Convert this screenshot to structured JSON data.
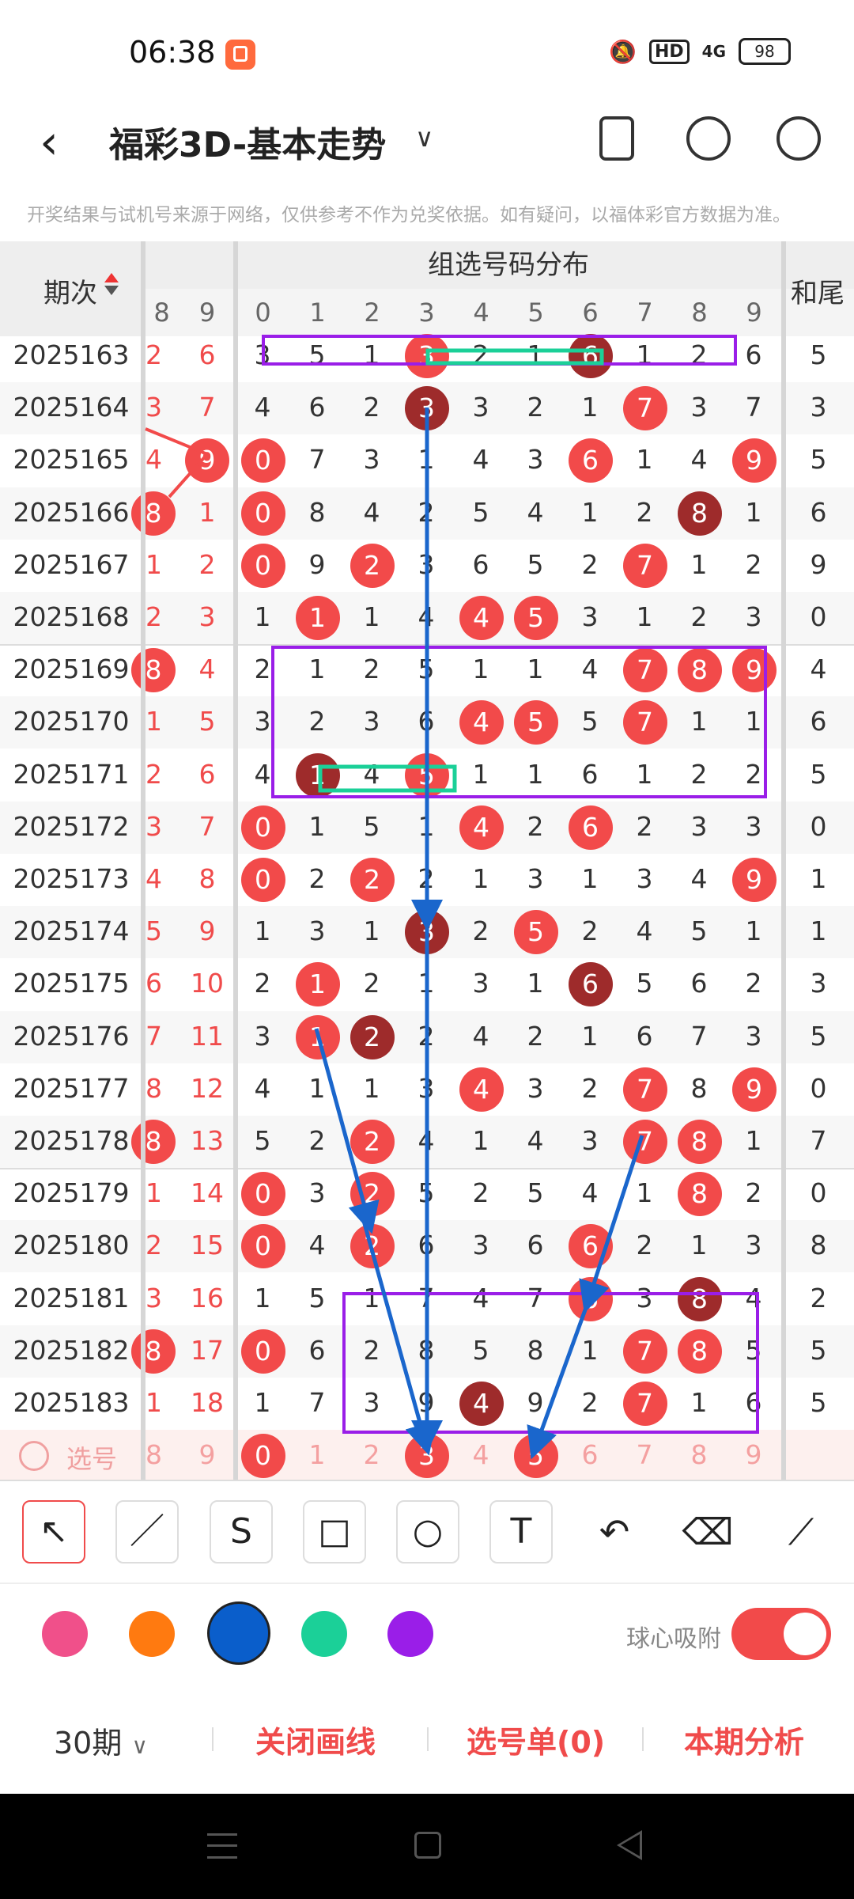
{
  "status": {
    "time": "06:38",
    "hd": "HD",
    "network": "4G",
    "battery": "98"
  },
  "header": {
    "title": "福彩3D-基本走势"
  },
  "disclaimer": "开奖结果与试机号来源于网络，仅供参考不作为兑奖依据。如有疑问，以福体彩官方数据为准。",
  "table": {
    "period_header": "期次",
    "group_header": "组选号码分布",
    "sum_header": "和尾",
    "partial_headers": [
      "8",
      "9"
    ],
    "digit_headers": [
      "0",
      "1",
      "2",
      "3",
      "4",
      "5",
      "6",
      "7",
      "8",
      "9"
    ],
    "rows": [
      {
        "period": "2025163",
        "a": "2",
        "b": "6",
        "g": [
          "3",
          "5",
          "1",
          "3",
          "2",
          "1",
          "6",
          "1",
          "2",
          "6"
        ],
        "balls": [
          3,
          6
        ],
        "dark": [
          6
        ],
        "sum": "5"
      },
      {
        "period": "2025164",
        "a": "3",
        "b": "7",
        "g": [
          "4",
          "6",
          "2",
          "3",
          "3",
          "2",
          "1",
          "7",
          "3",
          "7"
        ],
        "balls": [
          3,
          7
        ],
        "dark": [
          3
        ],
        "sum": "3"
      },
      {
        "period": "2025165",
        "a": "4",
        "b": "9",
        "g": [
          "0",
          "7",
          "3",
          "1",
          "4",
          "3",
          "6",
          "1",
          "4",
          "9"
        ],
        "balls": [
          0,
          6,
          9
        ],
        "dark": [],
        "sum": "5",
        "bBall": true
      },
      {
        "period": "2025166",
        "a": "8",
        "b": "1",
        "g": [
          "0",
          "8",
          "4",
          "2",
          "5",
          "4",
          "1",
          "2",
          "8",
          "1"
        ],
        "balls": [
          0,
          8
        ],
        "dark": [
          8
        ],
        "sum": "6",
        "aBall": true
      },
      {
        "period": "2025167",
        "a": "1",
        "b": "2",
        "g": [
          "0",
          "9",
          "2",
          "3",
          "6",
          "5",
          "2",
          "7",
          "1",
          "2"
        ],
        "balls": [
          0,
          2,
          7
        ],
        "dark": [],
        "sum": "9"
      },
      {
        "period": "2025168",
        "a": "2",
        "b": "3",
        "g": [
          "1",
          "1",
          "1",
          "4",
          "4",
          "5",
          "3",
          "1",
          "2",
          "3"
        ],
        "balls": [
          1,
          4,
          5
        ],
        "dark": [],
        "sum": "0"
      },
      {
        "period": "2025169",
        "a": "8",
        "b": "4",
        "g": [
          "2",
          "1",
          "2",
          "5",
          "1",
          "1",
          "4",
          "7",
          "8",
          "9"
        ],
        "balls": [
          7,
          8,
          9
        ],
        "dark": [],
        "sum": "4",
        "aBall": true
      },
      {
        "period": "2025170",
        "a": "1",
        "b": "5",
        "g": [
          "3",
          "2",
          "3",
          "6",
          "4",
          "5",
          "5",
          "7",
          "1",
          "1"
        ],
        "balls": [
          4,
          5,
          7
        ],
        "dark": [],
        "sum": "6"
      },
      {
        "period": "2025171",
        "a": "2",
        "b": "6",
        "g": [
          "4",
          "1",
          "4",
          "5",
          "1",
          "1",
          "6",
          "1",
          "2",
          "2"
        ],
        "balls": [
          1,
          3
        ],
        "dark": [
          1
        ],
        "sum": "5"
      },
      {
        "period": "2025172",
        "a": "3",
        "b": "7",
        "g": [
          "0",
          "1",
          "5",
          "1",
          "4",
          "2",
          "6",
          "2",
          "3",
          "3"
        ],
        "balls": [
          0,
          4,
          6
        ],
        "dark": [],
        "sum": "0"
      },
      {
        "period": "2025173",
        "a": "4",
        "b": "8",
        "g": [
          "0",
          "2",
          "2",
          "2",
          "1",
          "3",
          "1",
          "3",
          "4",
          "9"
        ],
        "balls": [
          0,
          2,
          9
        ],
        "dark": [],
        "sum": "1"
      },
      {
        "period": "2025174",
        "a": "5",
        "b": "9",
        "g": [
          "1",
          "3",
          "1",
          "3",
          "2",
          "5",
          "2",
          "4",
          "5",
          "1"
        ],
        "balls": [
          3,
          5
        ],
        "dark": [
          3
        ],
        "sum": "1"
      },
      {
        "period": "2025175",
        "a": "6",
        "b": "10",
        "g": [
          "2",
          "1",
          "2",
          "1",
          "3",
          "1",
          "6",
          "5",
          "6",
          "2"
        ],
        "balls": [
          1,
          6
        ],
        "dark": [
          6
        ],
        "sum": "3"
      },
      {
        "period": "2025176",
        "a": "7",
        "b": "11",
        "g": [
          "3",
          "1",
          "2",
          "2",
          "4",
          "2",
          "1",
          "6",
          "7",
          "3"
        ],
        "balls": [
          1,
          2
        ],
        "dark": [
          2
        ],
        "sum": "5"
      },
      {
        "period": "2025177",
        "a": "8",
        "b": "12",
        "g": [
          "4",
          "1",
          "1",
          "3",
          "4",
          "3",
          "2",
          "7",
          "8",
          "9"
        ],
        "balls": [
          4,
          7,
          9
        ],
        "dark": [],
        "sum": "0"
      },
      {
        "period": "2025178",
        "a": "8",
        "b": "13",
        "g": [
          "5",
          "2",
          "2",
          "4",
          "1",
          "4",
          "3",
          "7",
          "8",
          "1"
        ],
        "balls": [
          2,
          7,
          8
        ],
        "dark": [],
        "sum": "7",
        "aBall": true
      },
      {
        "period": "2025179",
        "a": "1",
        "b": "14",
        "g": [
          "0",
          "3",
          "2",
          "5",
          "2",
          "5",
          "4",
          "1",
          "8",
          "2"
        ],
        "balls": [
          0,
          2,
          8
        ],
        "dark": [],
        "sum": "0"
      },
      {
        "period": "2025180",
        "a": "2",
        "b": "15",
        "g": [
          "0",
          "4",
          "2",
          "6",
          "3",
          "6",
          "6",
          "2",
          "1",
          "3"
        ],
        "balls": [
          0,
          2,
          6
        ],
        "dark": [],
        "sum": "8"
      },
      {
        "period": "2025181",
        "a": "3",
        "b": "16",
        "g": [
          "1",
          "5",
          "1",
          "7",
          "4",
          "7",
          "6",
          "3",
          "8",
          "4"
        ],
        "balls": [
          6,
          8
        ],
        "dark": [
          8
        ],
        "sum": "2"
      },
      {
        "period": "2025182",
        "a": "8",
        "b": "17",
        "g": [
          "0",
          "6",
          "2",
          "8",
          "5",
          "8",
          "1",
          "7",
          "8",
          "5"
        ],
        "balls": [
          0,
          7,
          8
        ],
        "dark": [],
        "sum": "5",
        "aBall": true
      },
      {
        "period": "2025183",
        "a": "1",
        "b": "18",
        "g": [
          "1",
          "7",
          "3",
          "9",
          "4",
          "9",
          "2",
          "7",
          "1",
          "6"
        ],
        "balls": [
          4,
          7
        ],
        "dark": [
          4
        ],
        "sum": "5"
      }
    ],
    "pick_row": {
      "label": "选号",
      "a": "8",
      "b": "9",
      "g": [
        "0",
        "1",
        "2",
        "3",
        "4",
        "5",
        "6",
        "7",
        "8",
        "9"
      ],
      "balls": [
        0,
        3,
        5
      ]
    }
  },
  "tools": {
    "items": [
      "pointer-tool",
      "line-tool",
      "freehand-tool",
      "rectangle-tool",
      "circle-tool",
      "text-tool",
      "undo-tool",
      "eraser-tool",
      "clear-tool"
    ],
    "glyphs": [
      "↖",
      "／",
      "S",
      "□",
      "○",
      "T",
      "↶",
      "⌫",
      "⟋"
    ]
  },
  "colors": {
    "swatches": [
      "#f0508a",
      "#ff7a10",
      "#0a5ecb",
      "#1bd098",
      "#9a1ee8"
    ],
    "selected": "#0a5ecb",
    "accent": "#f04b4b",
    "ball_red": "#f24a4a",
    "ball_dark": "#9e2b2b"
  },
  "snap": {
    "label": "球心吸附",
    "on": true
  },
  "bottom": {
    "period_select": "30期",
    "close_lines": "关闭画线",
    "pick_list": "选号单(0)",
    "analysis": "本期分析"
  }
}
